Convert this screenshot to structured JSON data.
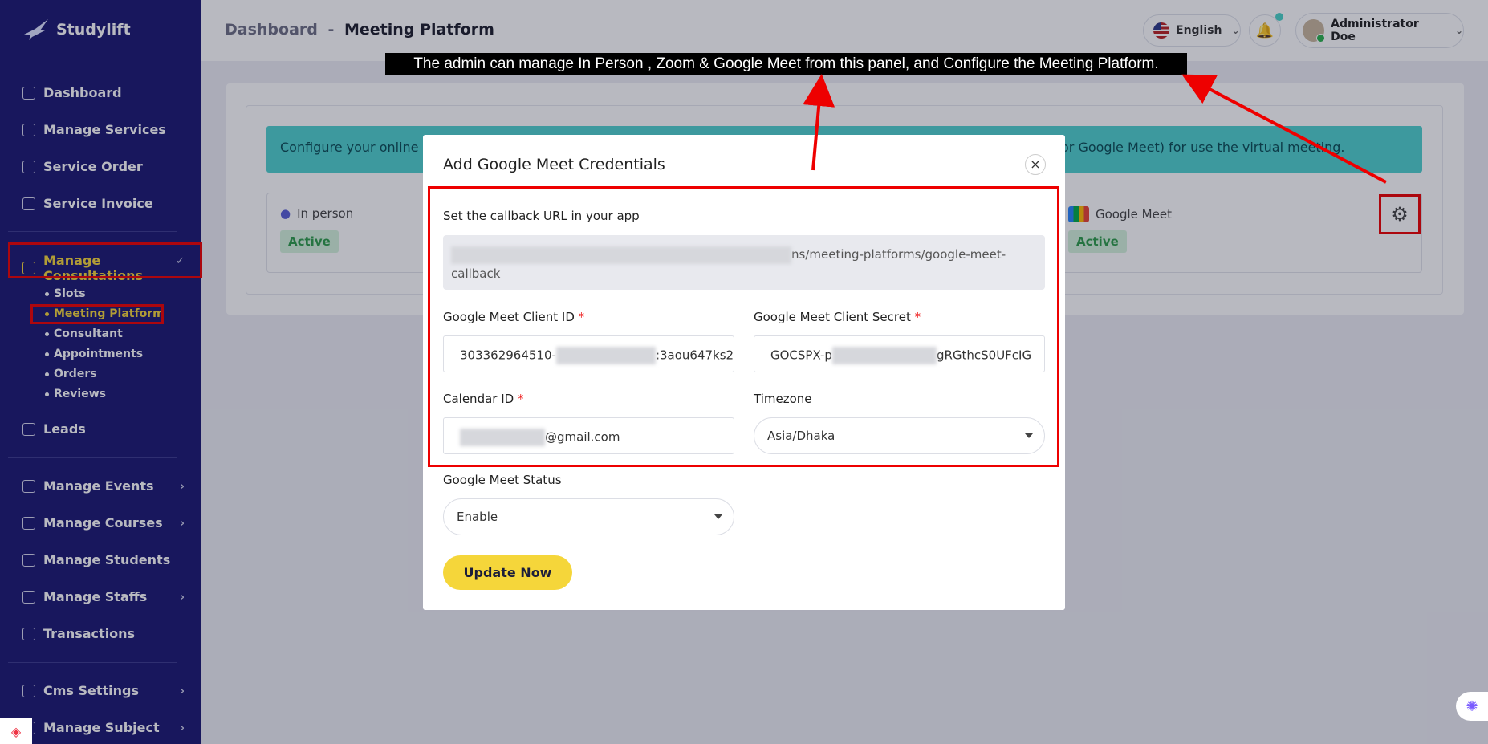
{
  "app": {
    "name": "Studylift"
  },
  "sidebar": {
    "items": [
      {
        "label": "Dashboard"
      },
      {
        "label": "Manage Services"
      },
      {
        "label": "Service Order"
      },
      {
        "label": "Service Invoice"
      },
      {
        "label": "Manage Consultations"
      },
      {
        "label": "Leads"
      },
      {
        "label": "Manage Events"
      },
      {
        "label": "Manage Courses"
      },
      {
        "label": "Manage Students"
      },
      {
        "label": "Manage Staffs"
      },
      {
        "label": "Transactions"
      },
      {
        "label": "Cms Settings"
      },
      {
        "label": "Manage Subject"
      }
    ],
    "sub_items": [
      {
        "label": "Slots"
      },
      {
        "label": "Meeting Platform"
      },
      {
        "label": "Consultant"
      },
      {
        "label": "Appointments"
      },
      {
        "label": "Orders"
      },
      {
        "label": "Reviews"
      }
    ]
  },
  "header": {
    "breadcrumb_root": "Dashboard",
    "breadcrumb_sep": "-",
    "breadcrumb_current": "Meeting Platform",
    "language": "English",
    "user_name": "Administrator Doe"
  },
  "page": {
    "info_text_left": "Configure your online c",
    "info_text_right": "or Google Meet) for use the virtual meeting.",
    "platforms": [
      {
        "name": "In person",
        "status": "Active"
      },
      {
        "name": "Google Meet",
        "status": "Active"
      }
    ]
  },
  "modal": {
    "title": "Add Google Meet Credentials",
    "callback_label": "Set the callback URL in your app",
    "callback_url_visible": "ns/meeting-platforms/google-meet-",
    "callback_url_tail": "callback",
    "client_id_label": "Google Meet Client ID",
    "client_id_prefix": "303362964510-",
    "client_id_suffix": ":3aou647ks2",
    "client_secret_label": "Google Meet Client Secret",
    "client_secret_prefix": "GOCSPX-p",
    "client_secret_suffix": "gRGthcS0UFcIG",
    "calendar_label": "Calendar ID",
    "calendar_suffix": "@gmail.com",
    "timezone_label": "Timezone",
    "timezone_value": "Asia/Dhaka",
    "status_label": "Google Meet Status",
    "status_value": "Enable",
    "submit_label": "Update Now",
    "required_mark": "*"
  },
  "annotation": {
    "tooltip": "The admin can manage In Person , Zoom & Google Meet from this panel, and Configure the Meeting Platform."
  },
  "colors": {
    "sidebar_bg": "#1b1872",
    "accent_yellow": "#f5d63a",
    "info_teal": "#4fd1cf",
    "highlight_red": "#e00000"
  },
  "icons": [
    "logo-bird-icon",
    "dashboard-icon",
    "services-icon",
    "order-icon",
    "invoice-icon",
    "consultation-icon",
    "leads-icon",
    "events-icon",
    "courses-icon",
    "students-icon",
    "staffs-icon",
    "transactions-icon",
    "cms-icon",
    "subject-icon",
    "bell-icon",
    "gear-icon",
    "close-icon",
    "chevron-down-icon",
    "person-icon",
    "google-meet-icon"
  ]
}
